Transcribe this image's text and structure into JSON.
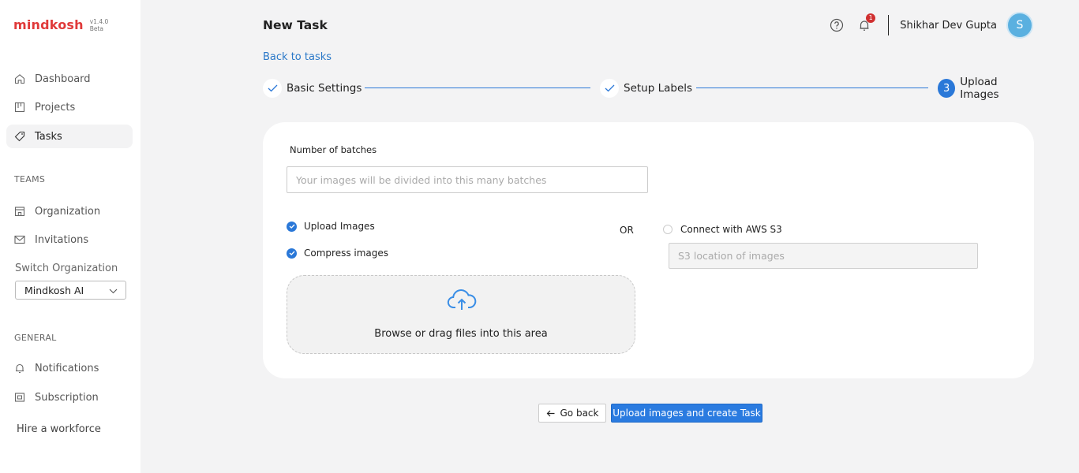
{
  "brand": {
    "name": "mindkosh",
    "version": "v1.4.0",
    "tag": "Beta"
  },
  "sidebar": {
    "nav": [
      {
        "label": "Dashboard",
        "icon": "home-icon"
      },
      {
        "label": "Projects",
        "icon": "projects-icon"
      },
      {
        "label": "Tasks",
        "icon": "tag-icon",
        "active": true
      }
    ],
    "teams_label": "TEAMS",
    "teams": [
      {
        "label": "Organization",
        "icon": "building-icon"
      },
      {
        "label": "Invitations",
        "icon": "mail-icon"
      }
    ],
    "switch_org_label": "Switch Organization",
    "org_selected": "Mindkosh AI",
    "general_label": "GENERAL",
    "general": [
      {
        "label": "Notifications",
        "icon": "bell-icon"
      },
      {
        "label": "Subscription",
        "icon": "card-icon"
      }
    ],
    "hire": "Hire a workforce"
  },
  "header": {
    "title": "New Task",
    "notifications_count": "1",
    "user_name": "Shikhar Dev Gupta",
    "avatar_initial": "S"
  },
  "back_link": "Back to tasks",
  "steps": [
    {
      "label": "Basic Settings",
      "status": "done"
    },
    {
      "label": "Setup Labels",
      "status": "done"
    },
    {
      "number": "3",
      "label": "Upload Images",
      "status": "current"
    }
  ],
  "form": {
    "batches_label": "Number of batches",
    "batches_placeholder": "Your images will be divided into this many batches",
    "upload_images_label": "Upload Images",
    "upload_images_checked": true,
    "compress_label": "Compress images",
    "compress_checked": true,
    "or_label": "OR",
    "aws_label": "Connect with AWS S3",
    "aws_selected": false,
    "s3_placeholder": "S3 location of images",
    "dropzone_text": "Browse or drag files into this area"
  },
  "actions": {
    "back_label": "Go back",
    "submit_label": "Upload images and create Task"
  },
  "colors": {
    "accent": "#2a78d8",
    "brand": "#e03a3a",
    "badge": "#d03030",
    "avatar": "#5ab0e0"
  }
}
